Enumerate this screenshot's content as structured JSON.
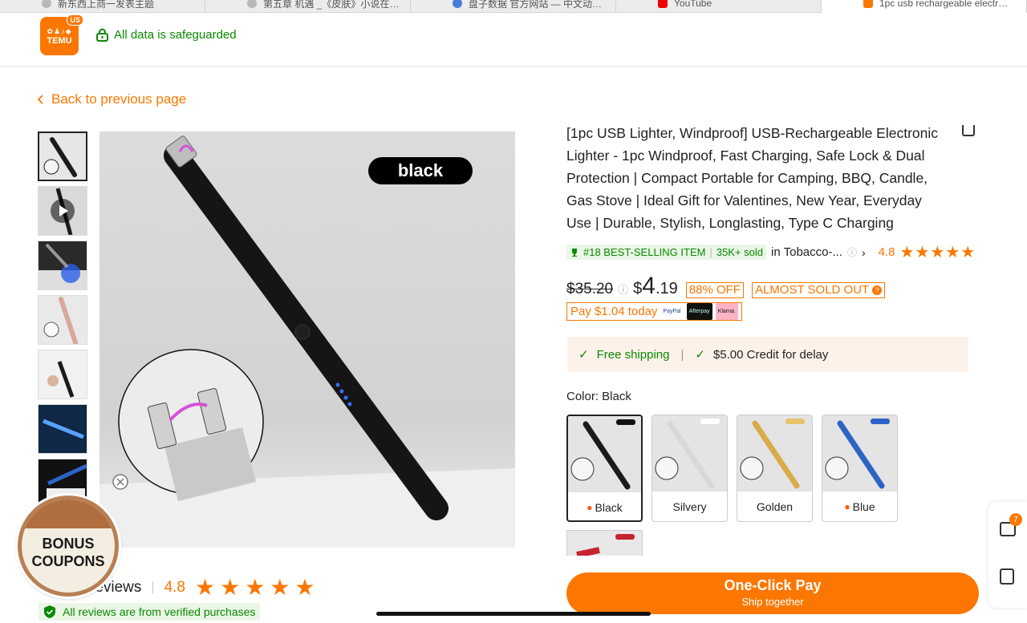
{
  "browser_tabs": [
    {
      "title": "新东西上商一发表主题"
    },
    {
      "title": "第五章 机遇 _《皮肤》小说在…"
    },
    {
      "title": "盘子数据 官方网站 — 中文动…"
    },
    {
      "title": "YouTube"
    },
    {
      "title": "1pc usb rechargeable electr…"
    }
  ],
  "header": {
    "logo_text": "TEMU",
    "logo_region": "US",
    "safe_text": "All data is safeguarded"
  },
  "nav": {
    "back_label": "Back to previous page"
  },
  "gallery": {
    "color_tag": "black"
  },
  "product": {
    "title": "[1pc USB Lighter, Windproof] USB-Rechargeable Electronic Lighter - 1pc Windproof, Fast Charging, Safe Lock & Dual Protection | Compact Portable for Camping, BBQ, Candle, Gas Stove | Ideal Gift for Valentines, New Year, Everyday Use | Durable, Stylish, Longlasting, Type C Charging",
    "best_selling": "#18 BEST-SELLING ITEM",
    "sold": "35K+ sold",
    "category": "in Tobacco-...",
    "rating": "4.8",
    "stars": 5,
    "old_price": "$35.20",
    "price_symbol": "$",
    "price_int": "4",
    "price_dec": ".19",
    "discount": "88% OFF",
    "stock_note": "ALMOST SOLD OUT",
    "pay_today": "Pay $1.04 today",
    "pay_methods": [
      "PayPal",
      "Afterpay",
      "Klarna."
    ],
    "free_shipping": "Free shipping",
    "credit_delay": "$5.00 Credit for delay",
    "color_label": "Color: Black",
    "colors": [
      {
        "label": "Black",
        "tag": "black",
        "color": "#1b1b1b",
        "hot": true
      },
      {
        "label": "Silvery",
        "tag": "silvery",
        "color": "#d8d8d8",
        "hot": false
      },
      {
        "label": "Golden",
        "tag": "golden",
        "color": "#d7ad4a",
        "hot": false
      },
      {
        "label": "Blue",
        "tag": "blue",
        "color": "#2e63c6",
        "hot": true
      },
      {
        "tag": "red",
        "color": "#c4252f"
      }
    ],
    "buy_button": {
      "title": "One-Click Pay",
      "subtitle": "Ship together"
    }
  },
  "reviews": {
    "label": "reviews",
    "rating": "4.8",
    "verified": "All reviews are from verified purchases"
  },
  "bonus": {
    "line1": "BONUS",
    "line2": "COUPONS"
  },
  "side": {
    "chat_count": "7"
  },
  "colors": {
    "accent": "#fb7701",
    "green": "#0a8800"
  }
}
